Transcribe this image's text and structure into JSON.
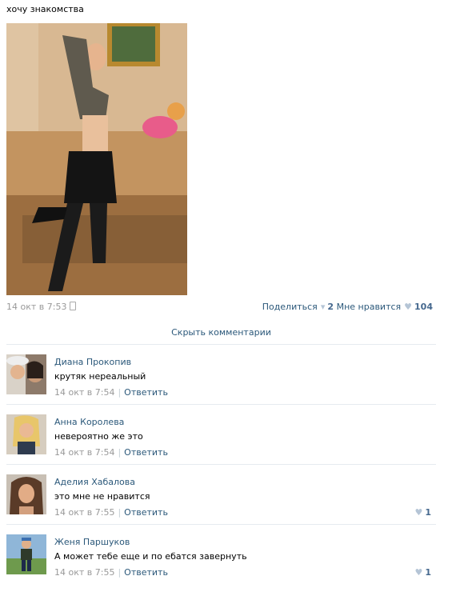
{
  "post": {
    "text": "хочу знакомства",
    "date": "14 окт в 7:53",
    "share_label": "Поделиться",
    "share_count": "2",
    "like_label": "Мне нравится",
    "like_count": "104"
  },
  "comments_toggle": "Скрыть комментарии",
  "comments": [
    {
      "author": "Диана Прокопив",
      "text": "крутяк нереальный",
      "date": "14 окт в 7:54",
      "reply": "Ответить",
      "likes": ""
    },
    {
      "author": "Анна Королева",
      "text": "невероятно же это",
      "date": "14 окт в 7:54",
      "reply": "Ответить",
      "likes": ""
    },
    {
      "author": "Аделия Хабалова",
      "text": "это мне не нравится",
      "date": "14 окт в 7:55",
      "reply": "Ответить",
      "likes": "1"
    },
    {
      "author": "Женя Паршуков",
      "text": "А может тебе еще и по ебатся завернуть",
      "date": "14 окт в 7:55",
      "reply": "Ответить",
      "likes": "1"
    }
  ],
  "icons": {
    "phone": "phone-icon",
    "share": "megaphone-icon",
    "like": "heart-icon"
  },
  "colors": {
    "link": "#2b587a",
    "meta": "#999999",
    "count": "#45688e",
    "divider": "#e5ebf0"
  }
}
